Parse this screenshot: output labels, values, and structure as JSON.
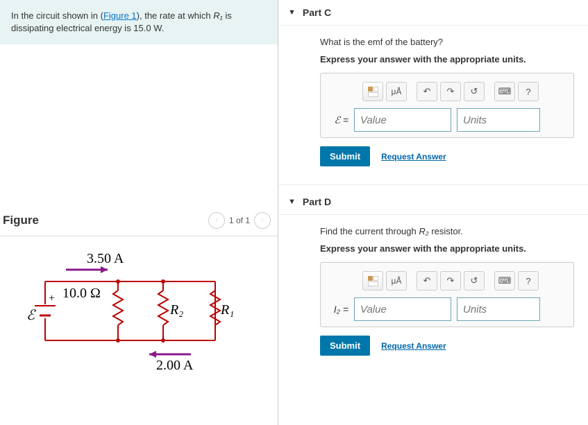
{
  "problem": {
    "prefix": "In the circuit shown in (",
    "link": "Figure 1",
    "mid": "), the rate at which ",
    "var": "R₁",
    "suffix": " is dissipating electrical energy is 15.0 W."
  },
  "figure": {
    "title": "Figure",
    "pager": "1 of 1",
    "labels": {
      "i_top": "3.50 A",
      "i_bottom": "2.00 A",
      "r_series": "10.0 Ω",
      "r2": "R₂",
      "r1": "R₁",
      "emf": "ℰ",
      "plus": "+"
    }
  },
  "parts": [
    {
      "id": "C",
      "title": "Part C",
      "question": "What is the emf of the battery?",
      "instruction": "Express your answer with the appropriate units.",
      "var_label": "ℰ =",
      "value_ph": "Value",
      "units_ph": "Units"
    },
    {
      "id": "D",
      "title": "Part D",
      "question_pre": "Find the current through ",
      "question_var": "R₂",
      "question_post": " resistor.",
      "instruction": "Express your answer with the appropriate units.",
      "var_label": "I₂ =",
      "value_ph": "Value",
      "units_ph": "Units"
    }
  ],
  "toolbar": {
    "units_symbol": "μÅ",
    "undo": "↶",
    "redo": "↷",
    "reset": "↺",
    "keyboard": "⌨",
    "help": "?"
  },
  "buttons": {
    "submit": "Submit",
    "request": "Request Answer"
  }
}
